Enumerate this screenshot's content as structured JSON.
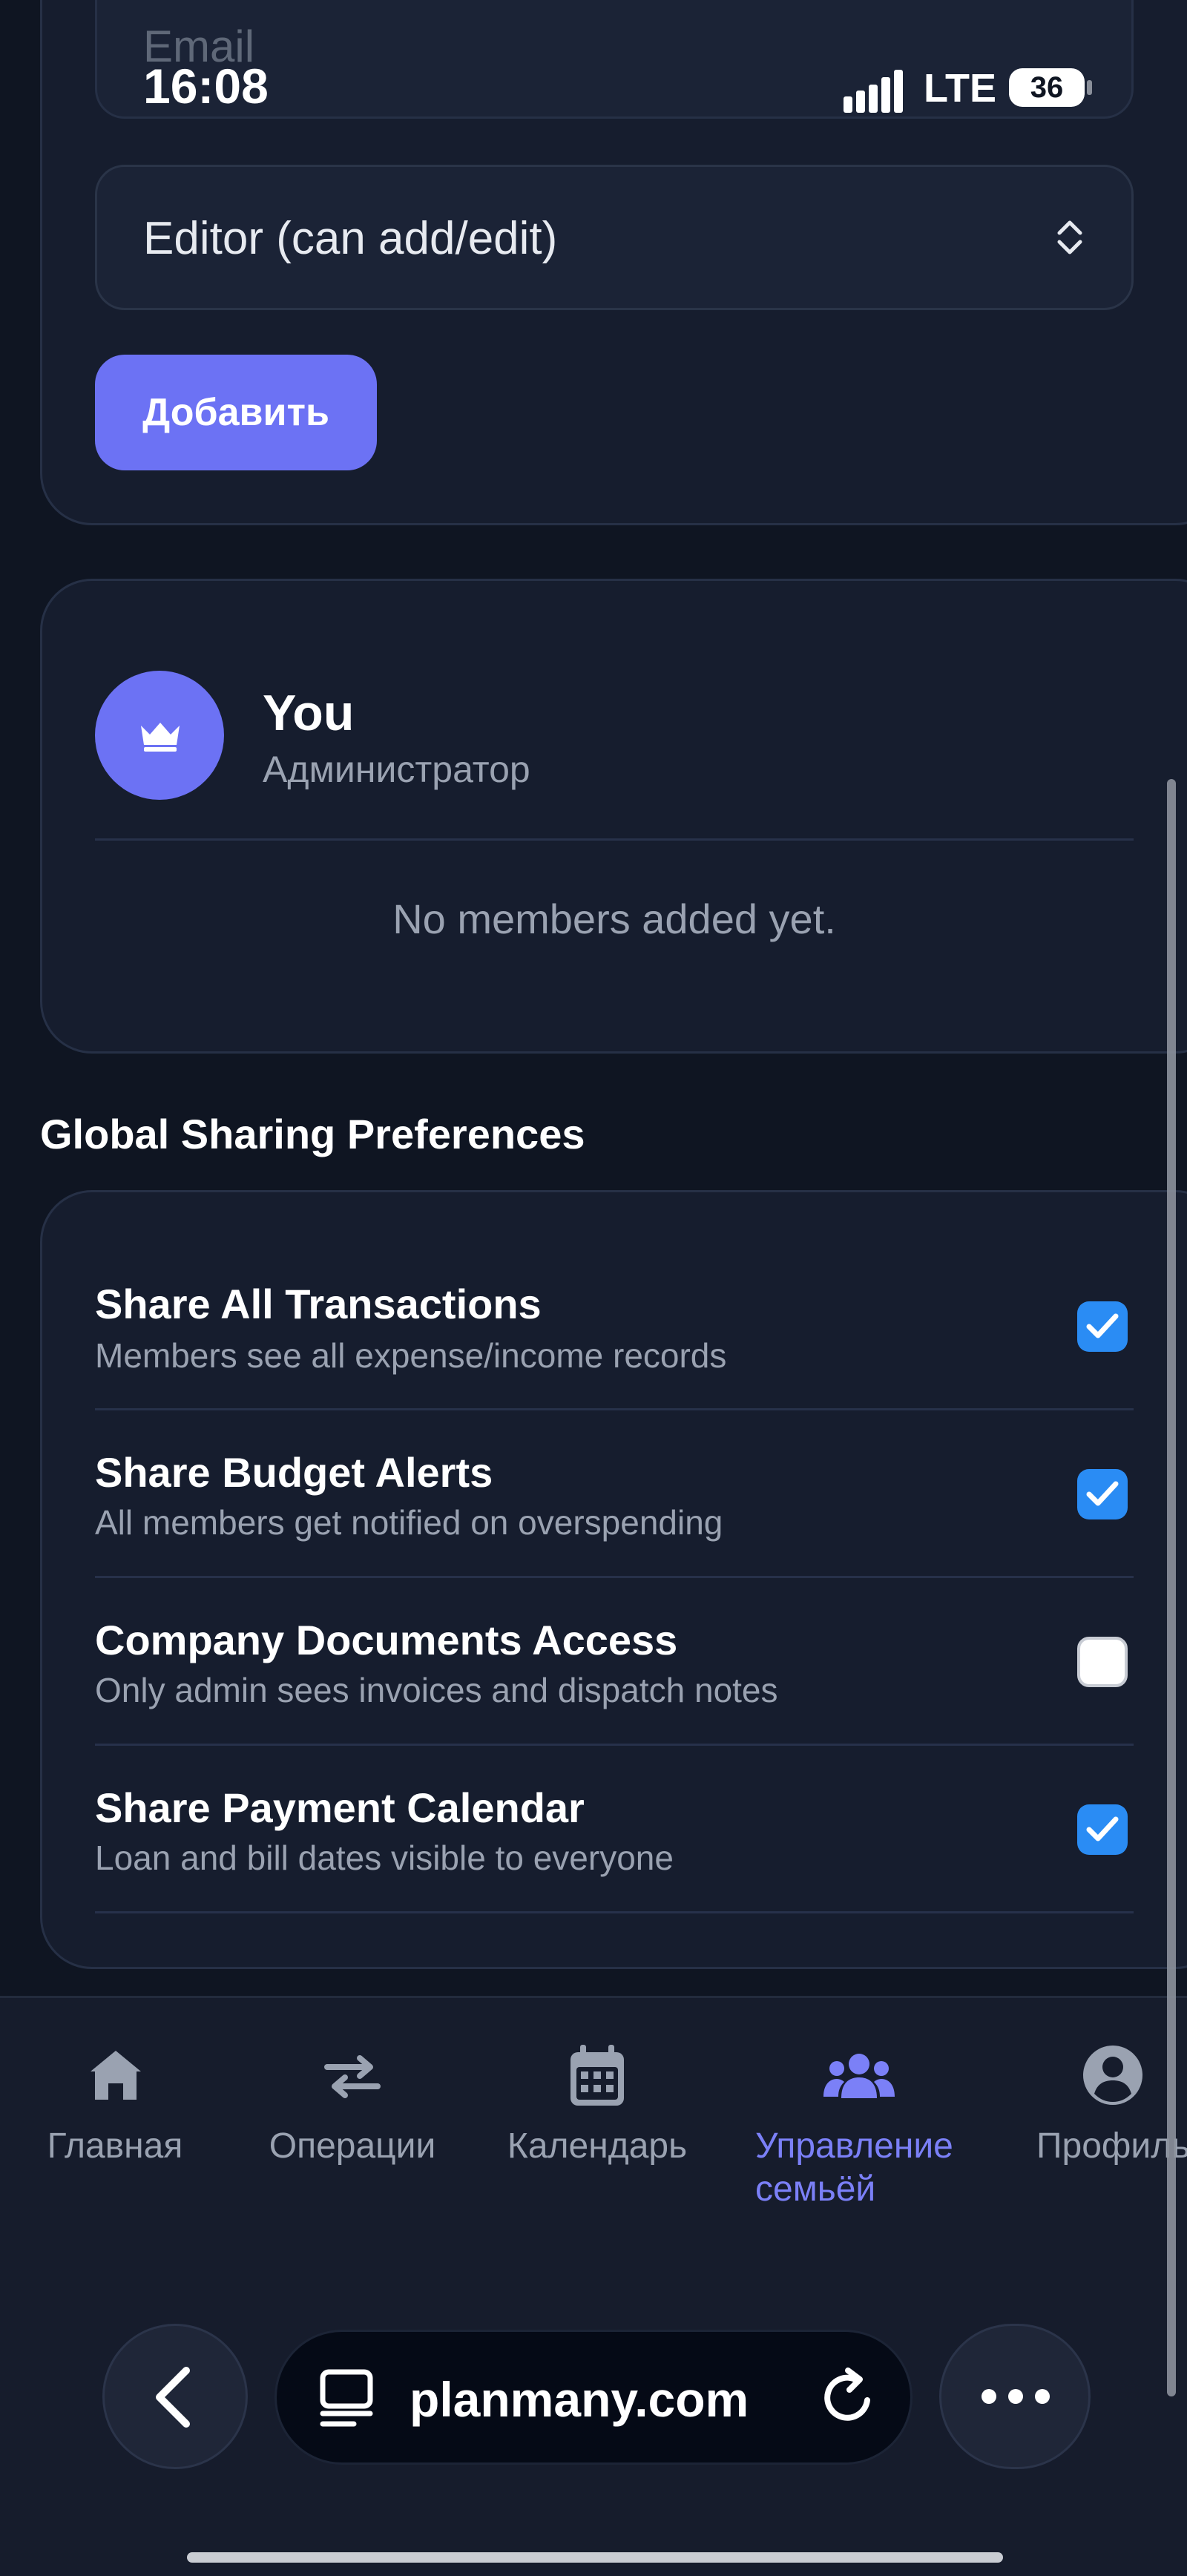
{
  "status_bar": {
    "time": "16:08",
    "network": "LTE",
    "battery": "36"
  },
  "form": {
    "email_placeholder": "Email",
    "role_selected": "Editor (can add/edit)",
    "add_label": "Добавить"
  },
  "members": {
    "owner_name": "You",
    "owner_role": "Администратор",
    "empty_message": "No members added yet."
  },
  "preferences": {
    "title": "Global Sharing Preferences",
    "items": [
      {
        "title": "Share All Transactions",
        "desc": "Members see all expense/income records",
        "checked": true
      },
      {
        "title": "Share Budget Alerts",
        "desc": "All members get notified on overspending",
        "checked": true
      },
      {
        "title": "Company Documents Access",
        "desc": "Only admin sees invoices and dispatch notes",
        "checked": false
      },
      {
        "title": "Share Payment Calendar",
        "desc": "Loan and bill dates visible to everyone",
        "checked": true
      }
    ]
  },
  "bottom_nav": {
    "items": [
      {
        "label": "Главная",
        "icon": "home-icon",
        "active": false
      },
      {
        "label": "Операции",
        "icon": "transfer-arrows-icon",
        "active": false
      },
      {
        "label": "Календарь",
        "icon": "calendar-icon",
        "active": false
      },
      {
        "label_line1": "Управление",
        "label_line2": "семьёй",
        "icon": "family-group-icon",
        "active": true
      },
      {
        "label": "Профиль",
        "icon": "profile-icon",
        "active": false
      }
    ]
  },
  "browser": {
    "url": "planmany.com"
  },
  "colors": {
    "accent": "#6c72f4",
    "checkbox_on": "#2a8cf4",
    "background": "#0f1522",
    "card": "#161d2e"
  }
}
